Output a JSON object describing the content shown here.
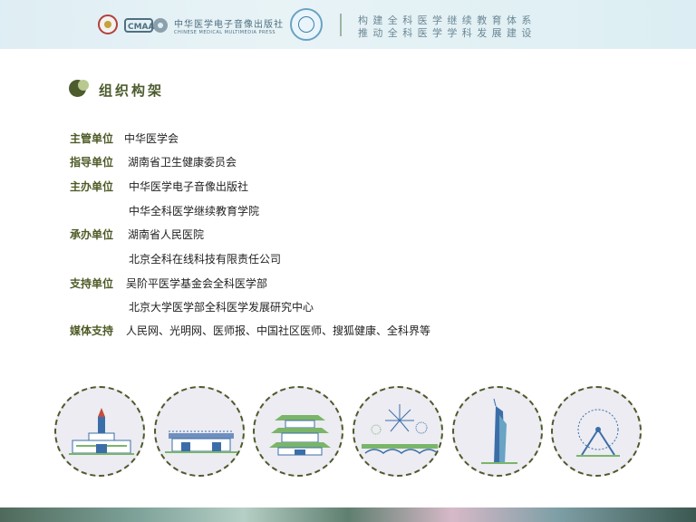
{
  "header": {
    "publisher_cn": "中华医学电子音像出版社",
    "publisher_en": "CHINESE MEDICAL MULTIMEDIA PRESS",
    "slogan_line1": "构建全科医学继续教育体系",
    "slogan_line2": "推动全科医学学科发展建设"
  },
  "section": {
    "title": "组织构架"
  },
  "organization": {
    "rows": [
      {
        "label": "主管单位",
        "value": "中华医学会"
      },
      {
        "label": "指导单位",
        "value": "湖南省卫生健康委员会"
      },
      {
        "label": "主办单位",
        "value": "中华医学电子音像出版社"
      },
      {
        "label": "",
        "value": "中华全科医学继续教育学院"
      },
      {
        "label": "承办单位",
        "value": "湖南省人民医院"
      },
      {
        "label": "",
        "value": "北京全科在线科技有限责任公司"
      },
      {
        "label": "支持单位",
        "value": "吴阶平医学基金会全科医学部"
      },
      {
        "label": "",
        "value": "北京大学医学部全科医学发展研究中心"
      },
      {
        "label": "媒体支持",
        "value": "人民网、光明网、医师报、中国社区医师、搜狐健康、全科界等"
      }
    ]
  },
  "landmark_icons": [
    "tower-hall-icon",
    "station-building-icon",
    "pavilion-icon",
    "fireworks-bridge-icon",
    "skyscraper-icon",
    "ferris-wheel-icon"
  ]
}
